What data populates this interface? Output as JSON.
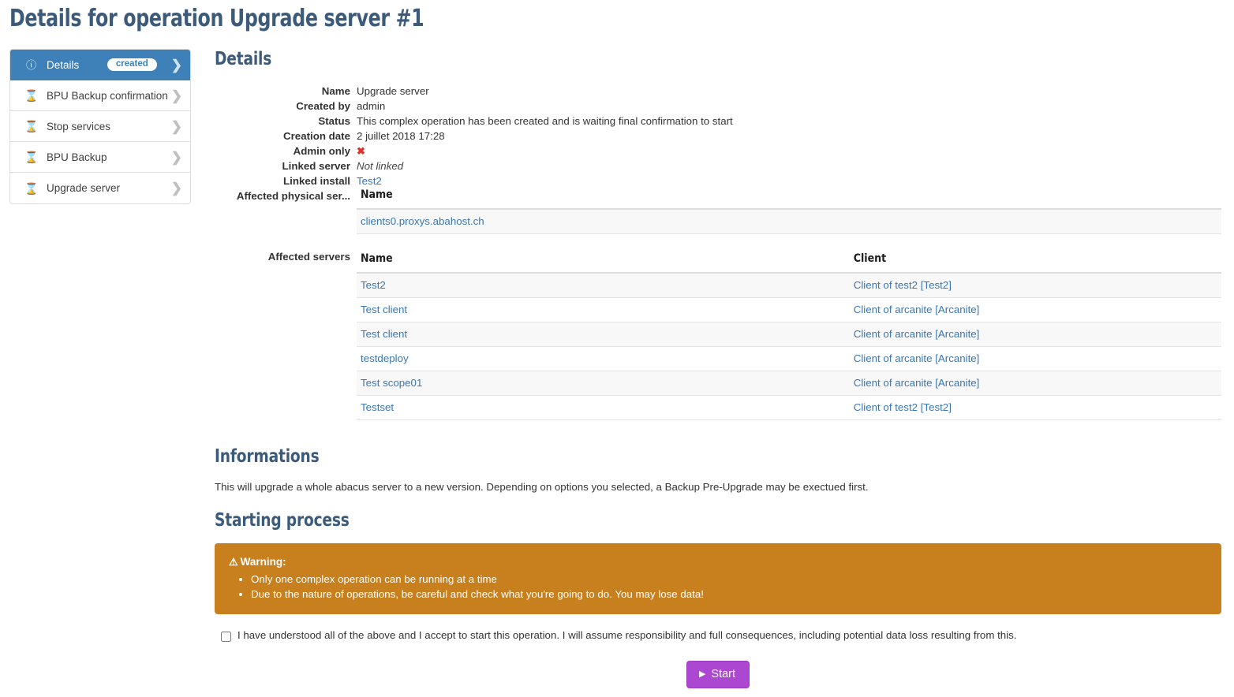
{
  "page": {
    "title": "Details for operation Upgrade server #1"
  },
  "sidebar": {
    "items": [
      {
        "label": "Details",
        "icon": "info-circle-icon",
        "badge": "created",
        "chevron": "chevron-right-icon",
        "active": true
      },
      {
        "label": "BPU Backup confirmation",
        "icon": "hourglass-icon",
        "badge": "",
        "chevron": "chevron-right-icon",
        "active": false
      },
      {
        "label": "Stop services",
        "icon": "hourglass-icon",
        "badge": "",
        "chevron": "chevron-right-icon",
        "active": false
      },
      {
        "label": "BPU Backup",
        "icon": "hourglass-icon",
        "badge": "",
        "chevron": "chevron-right-icon",
        "active": false
      },
      {
        "label": "Upgrade server",
        "icon": "hourglass-icon",
        "badge": "",
        "chevron": "chevron-right-icon",
        "active": false
      }
    ]
  },
  "details": {
    "heading": "Details",
    "fields": {
      "name_label": "Name",
      "name_value": "Upgrade server",
      "created_by_label": "Created by",
      "created_by_value": "admin",
      "status_label": "Status",
      "status_value": "This complex operation has been created and is waiting final confirmation to start",
      "creation_date_label": "Creation date",
      "creation_date_value": "2 juillet 2018 17:28",
      "admin_only_label": "Admin only",
      "admin_only_value": "✖",
      "linked_server_label": "Linked server",
      "linked_server_value": "Not linked",
      "linked_install_label": "Linked install",
      "linked_install_value": "Test2",
      "affected_physical_label": "Affected physical ser...",
      "affected_servers_label": "Affected servers"
    },
    "physical_servers_table": {
      "columns": [
        "Name"
      ],
      "rows": [
        {
          "name": "clients0.proxys.abahost.ch"
        }
      ]
    },
    "affected_servers_table": {
      "columns": [
        "Name",
        "Client"
      ],
      "rows": [
        {
          "name": "Test2",
          "client": "Client of test2 [Test2]"
        },
        {
          "name": "Test client",
          "client": "Client of arcanite [Arcanite]"
        },
        {
          "name": "Test client",
          "client": "Client of arcanite [Arcanite]"
        },
        {
          "name": "testdeploy",
          "client": "Client of arcanite [Arcanite]"
        },
        {
          "name": "Test scope01",
          "client": "Client of arcanite [Arcanite]"
        },
        {
          "name": "Testset",
          "client": "Client of test2 [Test2]"
        }
      ]
    }
  },
  "informations": {
    "heading": "Informations",
    "text": "This will upgrade a whole abacus server to a new version. Depending on options you selected, a Backup Pre-Upgrade may be exectued first."
  },
  "starting_process": {
    "heading": "Starting process",
    "warning": {
      "icon": "warning-triangle-icon",
      "title": "Warning:",
      "bullets": [
        "Only one complex operation can be running at a time",
        "Due to the nature of operations, be careful and check what you're going to do. You may lose data!"
      ]
    },
    "accept_label": "I have understood all of the above and I accept to start this operation. I will assume responsibility and full consequences, including potential data loss resulting from this.",
    "accept_checked": false,
    "start_button": {
      "label": "Start",
      "icon": "play-icon"
    }
  },
  "colors": {
    "accent_blue": "#3e80b8",
    "heading_blue": "#3c5a7a",
    "link_blue": "#3a76af",
    "warning_orange": "#c8801f",
    "start_purple": "#ab47d0",
    "hourglass_orange": "#f0a030",
    "danger_red": "#d9342b"
  }
}
